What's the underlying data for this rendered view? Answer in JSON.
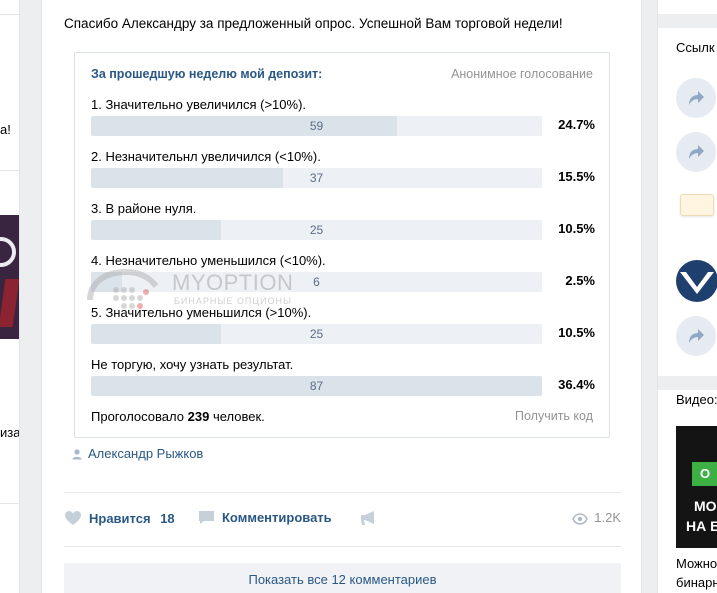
{
  "left_fragments": [
    "а!",
    "иза,"
  ],
  "post": {
    "text": "Спасибо Александру за предложенный опрос. Успешной Вам торговой недели!",
    "poll": {
      "title": "За прошедшую неделю мой депозит:",
      "anonymous_label": "Анонимное голосование",
      "options": [
        {
          "label": "1. Значительно увеличился (>10%).",
          "votes": "59",
          "percent": "24.7%",
          "share": 0.247,
          "checked": false
        },
        {
          "label": "2. Незначительнл увеличился (<10%).",
          "votes": "37",
          "percent": "15.5%",
          "share": 0.155,
          "checked": false
        },
        {
          "label": "3. В районе нуля.",
          "votes": "25",
          "percent": "10.5%",
          "share": 0.105,
          "checked": false
        },
        {
          "label": "4. Незначительно уменьшился (<10%).",
          "votes": "6",
          "percent": "2.5%",
          "share": 0.025,
          "checked": false
        },
        {
          "label": "5. Значительно уменьшился (>10%).",
          "votes": "25",
          "percent": "10.5%",
          "share": 0.105,
          "checked": false
        },
        {
          "label": "Не торгую, хочу узнать результат.",
          "votes": "87",
          "percent": "36.4%",
          "share": 0.364,
          "checked": true
        }
      ],
      "total_prefix": "Проголосовало",
      "total_count": "239",
      "total_suffix": "человек.",
      "get_code_label": "Получить код"
    },
    "author": "Александр Рыжков",
    "actions": {
      "like_label": "Нравится",
      "like_count": "18",
      "comment_label": "Комментировать",
      "views": "1.2K"
    },
    "show_all_comments": "Показать все 12 комментариев"
  },
  "watermark": {
    "brand": "MYOPTION",
    "tagline": "БИНАРНЫЕ ОПЦИОНЫ"
  },
  "right_col": {
    "links_label": "Ссылк",
    "video_label": "Видео:",
    "ad_text_1": "МО",
    "ad_text_2": "НА Б",
    "ad_button": "О",
    "caption_1": "Можно",
    "caption_2": "бинарн"
  },
  "colors": {
    "link": "#2a5885",
    "bar_bg": "#edf0f5",
    "bar_fill": "#dae2ea",
    "page_bg": "#edeef0"
  }
}
